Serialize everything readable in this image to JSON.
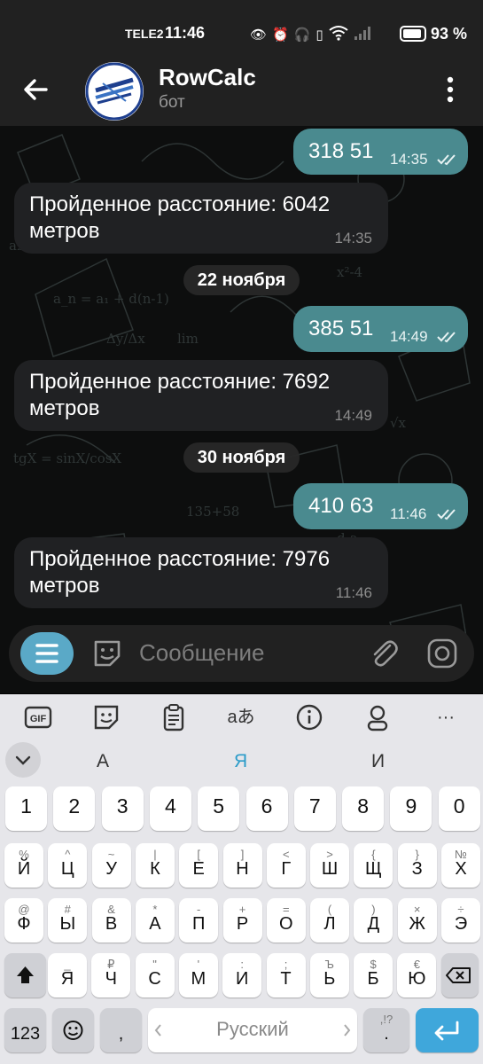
{
  "status_bar": {
    "carrier": "TELE2",
    "time": "11:46",
    "battery": "93 %"
  },
  "header": {
    "title": "RowCalc",
    "subtitle": "бот"
  },
  "messages": [
    {
      "text": "318 51",
      "time": "14:35"
    },
    {
      "text": "Пройденное расстояние: 6042 метров",
      "time": "14:35"
    },
    {
      "text": "22 ноября"
    },
    {
      "text": "385 51",
      "time": "14:49"
    },
    {
      "text": "Пройденное расстояние: 7692 метров",
      "time": "14:49"
    },
    {
      "text": "30 ноября"
    },
    {
      "text": "410 63",
      "time": "11:46"
    },
    {
      "text": "Пройденное расстояние: 7976 метров",
      "time": "11:46"
    }
  ],
  "input": {
    "placeholder": "Сообщение"
  },
  "keyboard": {
    "toolbar": {
      "gif": "GIF",
      "translate": "aあ",
      "more": "···"
    },
    "suggestions": [
      "А",
      "Я",
      "И"
    ],
    "number_row": [
      "1",
      "2",
      "3",
      "4",
      "5",
      "6",
      "7",
      "8",
      "9",
      "0"
    ],
    "row1": [
      {
        "main": "Й",
        "hint": "%"
      },
      {
        "main": "Ц",
        "hint": "^"
      },
      {
        "main": "У",
        "hint": "~"
      },
      {
        "main": "К",
        "hint": "|"
      },
      {
        "main": "Е",
        "hint": "["
      },
      {
        "main": "Н",
        "hint": "]"
      },
      {
        "main": "Г",
        "hint": "<"
      },
      {
        "main": "Ш",
        "hint": ">"
      },
      {
        "main": "Щ",
        "hint": "{"
      },
      {
        "main": "З",
        "hint": "}"
      },
      {
        "main": "Х",
        "hint": "№"
      }
    ],
    "row2": [
      {
        "main": "Ф",
        "hint": "@"
      },
      {
        "main": "Ы",
        "hint": "#"
      },
      {
        "main": "В",
        "hint": "&"
      },
      {
        "main": "А",
        "hint": "*"
      },
      {
        "main": "П",
        "hint": "-"
      },
      {
        "main": "Р",
        "hint": "+"
      },
      {
        "main": "О",
        "hint": "="
      },
      {
        "main": "Л",
        "hint": "("
      },
      {
        "main": "Д",
        "hint": ")"
      },
      {
        "main": "Ж",
        "hint": "×"
      },
      {
        "main": "Э",
        "hint": "÷"
      }
    ],
    "row3": [
      {
        "main": "Я",
        "hint": "_"
      },
      {
        "main": "Ч",
        "hint": "₽"
      },
      {
        "main": "С",
        "hint": "\""
      },
      {
        "main": "М",
        "hint": "'"
      },
      {
        "main": "И",
        "hint": ":"
      },
      {
        "main": "Т",
        "hint": ";"
      },
      {
        "main": "Ь",
        "hint": "Ъ"
      },
      {
        "main": "Б",
        "hint": "$"
      },
      {
        "main": "Ю",
        "hint": "€"
      }
    ],
    "symbols_key": "123",
    "comma_key": ",",
    "space_label": "Русский",
    "period_key": ".",
    "period_hint": ",!?"
  },
  "colors": {
    "outgoing_bubble": "#4a8a8f",
    "incoming_bubble": "#202123",
    "accent": "#5aa9c7",
    "enter_key": "#3fa7db"
  }
}
